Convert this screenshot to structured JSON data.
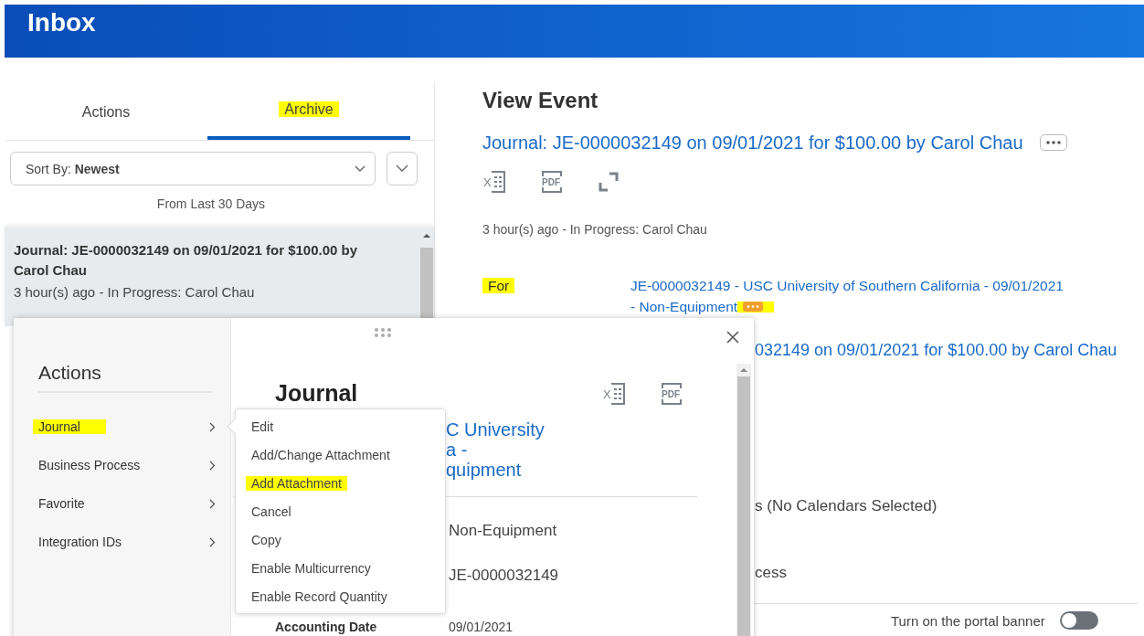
{
  "header": {
    "title": "Inbox"
  },
  "tabs": [
    {
      "label": "Actions",
      "selected": false,
      "highlighted": false
    },
    {
      "label": "Archive",
      "selected": true,
      "highlighted": true
    }
  ],
  "sort": {
    "label": "Sort By:",
    "value": "Newest"
  },
  "filter_note": "From Last 30 Days",
  "inbox_items": [
    {
      "title": "Journal: JE-0000032149 on 09/01/2021 for $100.00 by Carol Chau",
      "status": "3 hour(s) ago - In Progress: Carol Chau",
      "selected": true
    }
  ],
  "event": {
    "heading": "View Event",
    "title_link": "Journal: JE-0000032149 on 09/01/2021 for $100.00 by Carol Chau",
    "export_icons": [
      {
        "kind": "excel",
        "text": "X"
      },
      {
        "kind": "pdf",
        "text": "PDF"
      },
      {
        "kind": "expand"
      }
    ],
    "status": "3 hour(s) ago - In Progress: Carol Chau",
    "fields": [
      {
        "label": "For",
        "label_highlighted": true,
        "value_lines": [
          "JE-0000032149 - USC University of Southern California - 09/01/2021",
          "- Non-Equipment"
        ],
        "related_actions_highlighted": true
      }
    ],
    "fragments": [
      {
        "kind": "link",
        "text": "032149 on 09/01/2021 for $100.00 by Carol Chau"
      },
      {
        "kind": "text",
        "text": "s (No Calendars Selected)"
      },
      {
        "kind": "text",
        "text": "cess"
      }
    ],
    "banner_toggle": {
      "label": "Turn on the portal banner",
      "on": false
    }
  },
  "popup": {
    "heading": "Actions",
    "categories": [
      {
        "label": "Journal",
        "highlighted": true
      },
      {
        "label": "Business Process",
        "highlighted": false
      },
      {
        "label": "Favorite",
        "highlighted": false
      },
      {
        "label": "Integration IDs",
        "highlighted": false
      }
    ],
    "title": "Journal",
    "export_icons": [
      {
        "kind": "excel",
        "text": "X"
      },
      {
        "kind": "pdf",
        "text": "PDF"
      }
    ],
    "link_fragments": [
      "C University",
      "a -",
      "quipment"
    ],
    "values": [
      "Non-Equipment",
      "JE-0000032149"
    ],
    "date_field": {
      "label": "Accounting Date",
      "value": "09/01/2021"
    },
    "submenu": [
      {
        "label": "Edit",
        "highlighted": false
      },
      {
        "label": "Add/Change Attachment",
        "highlighted": false
      },
      {
        "label": "Add Attachment",
        "highlighted": true
      },
      {
        "label": "Cancel",
        "highlighted": false
      },
      {
        "label": "Copy",
        "highlighted": false
      },
      {
        "label": "Enable Multicurrency",
        "highlighted": false
      },
      {
        "label": "Enable Record Quantity",
        "highlighted": false
      }
    ]
  }
}
